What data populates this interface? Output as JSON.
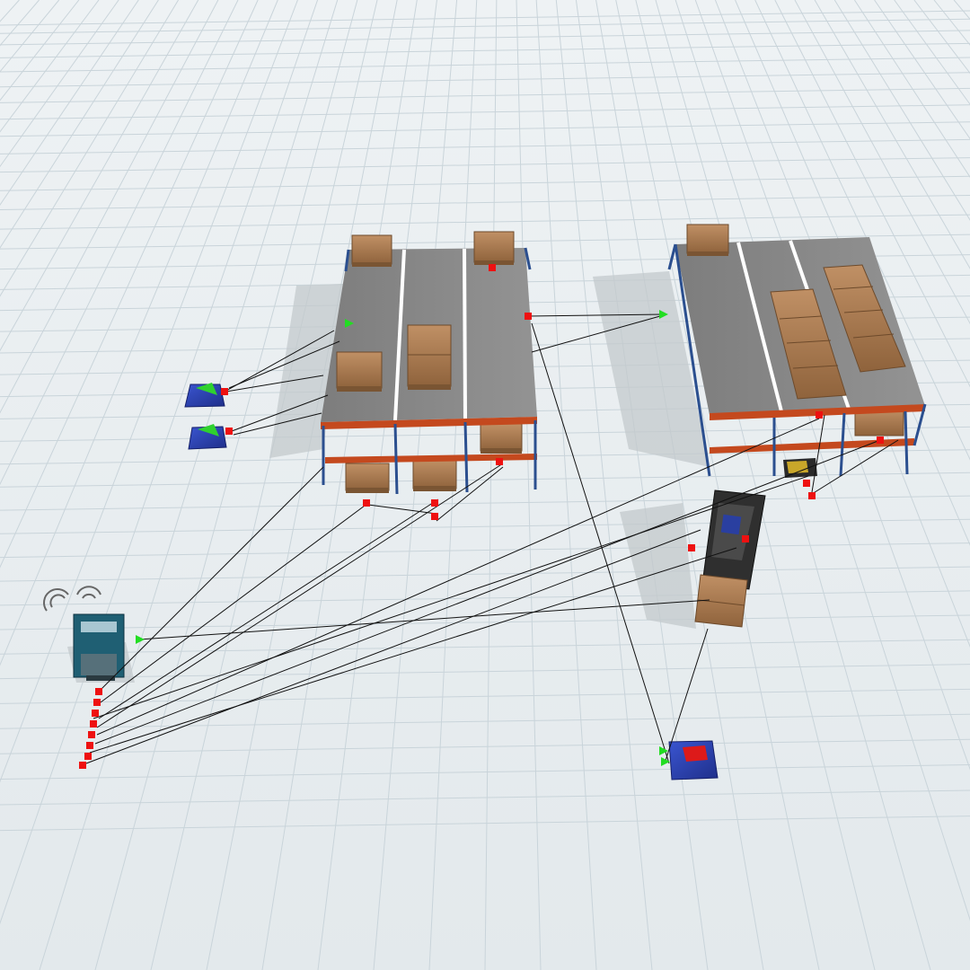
{
  "view": {
    "type": "3d-simulation-viewport",
    "grid": true
  },
  "colors": {
    "floor": "#e8eef1",
    "grid_line": "#c7d3da",
    "rack_frame_blue": "#2b4f8f",
    "rack_beam_orange": "#c4491e",
    "rack_deck": "#858585",
    "pallet_box": "#a9784c",
    "queue_pad": "#2d45b8",
    "port_input": "#22dd22",
    "port_output": "#ee1111",
    "connector_line": "#111111",
    "dispatcher_body": "#1f5f73",
    "forklift_body": "#333333"
  },
  "objects": [
    {
      "name": "rack-left",
      "icon": "storage-rack-icon"
    },
    {
      "name": "rack-right",
      "icon": "storage-rack-icon"
    },
    {
      "name": "queue-upper-left",
      "icon": "queue-pad-icon"
    },
    {
      "name": "queue-lower-left",
      "icon": "queue-pad-icon"
    },
    {
      "name": "queue-bottom-right",
      "icon": "queue-pad-icon"
    },
    {
      "name": "dispatcher",
      "icon": "dispatcher-tower-icon"
    },
    {
      "name": "forklift",
      "icon": "forklift-icon"
    },
    {
      "name": "network-node-small",
      "icon": "network-node-icon"
    }
  ]
}
